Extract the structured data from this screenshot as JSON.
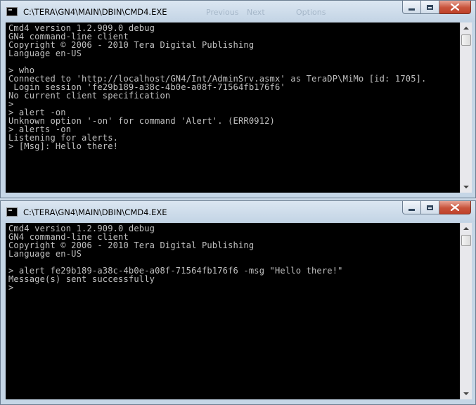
{
  "windows": [
    {
      "title": "C:\\TERA\\GN4\\MAIN\\DBIN\\CMD4.EXE",
      "lines": [
        "Cmd4 version 1.2.909.0 debug",
        "GN4 command-line client",
        "Copyright © 2006 - 2010 Tera Digital Publishing",
        "Language en-US",
        "",
        "> who",
        "Connected to 'http://localhost/GN4/Int/AdminSrv.asmx' as TeraDP\\MiMo [id: 1705].",
        " Login session 'fe29b189-a38c-4b0e-a08f-71564fb176f6'",
        "No current client specification",
        ">",
        "> alert -on",
        "Unknown option '-on' for command 'Alert'. (ERR0912)",
        "> alerts -on",
        "Listening for alerts.",
        "> [Msg]: Hello there!"
      ]
    },
    {
      "title": "C:\\TERA\\GN4\\MAIN\\DBIN\\CMD4.EXE",
      "lines": [
        "Cmd4 version 1.2.909.0 debug",
        "GN4 command-line client",
        "Copyright © 2006 - 2010 Tera Digital Publishing",
        "Language en-US",
        "",
        "> alert fe29b189-a38c-4b0e-a08f-71564fb176f6 -msg \"Hello there!\"",
        "Message(s) sent successfully",
        ">"
      ]
    }
  ],
  "background_ghost": {
    "previous": "Previous",
    "next": "Next",
    "options": "Options"
  },
  "caption_buttons": {
    "close_glyph": "✕"
  },
  "colors": {
    "console_bg": "#000000",
    "console_text": "#c0c0c0",
    "close_button": "#c8533b"
  }
}
